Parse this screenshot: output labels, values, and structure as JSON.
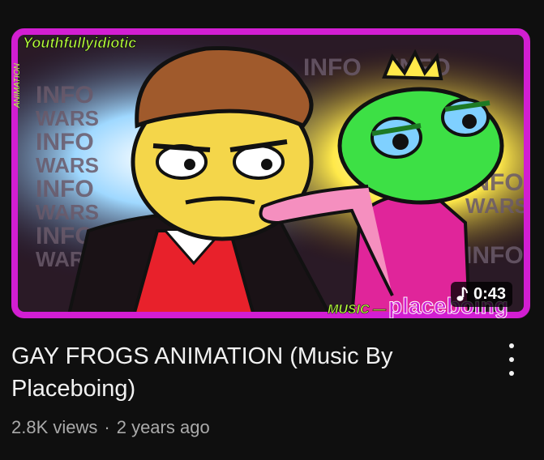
{
  "video": {
    "title": "GAY FROGS ANIMATION (Music By Placeboing)",
    "duration": "0:43",
    "views": "2.8K views",
    "separator": "·",
    "age": "2 years ago"
  },
  "thumbnail": {
    "watermark": "Youthfullyidiotic",
    "side_caption": "ANIMATION",
    "bg_text_top": "INFO",
    "bg_text_bottom": "WARS",
    "music_credit_prefix": "MUSIC —",
    "music_credit_name": "placeboing"
  },
  "icons": {
    "duration": "music-note-icon",
    "menu": "more-vertical-icon"
  },
  "colors": {
    "background": "#0f0f0f",
    "border": "#d21ed2",
    "frog": "#3de045",
    "title_text": "#f1f1f1",
    "meta_text": "#aaaaaa"
  }
}
